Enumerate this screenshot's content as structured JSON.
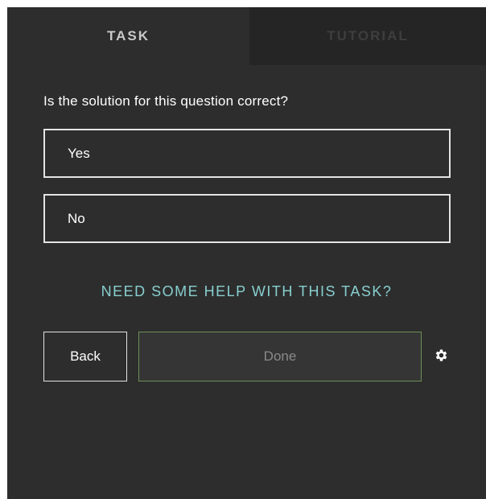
{
  "tabs": [
    {
      "label": "TASK",
      "active": true
    },
    {
      "label": "TUTORIAL",
      "active": false
    }
  ],
  "task": {
    "question": "Is the solution for this question correct?",
    "answers": [
      "Yes",
      "No"
    ],
    "help_link": "NEED SOME HELP WITH THIS TASK?"
  },
  "footer": {
    "back_label": "Back",
    "done_label": "Done",
    "settings_icon": "gear-icon"
  },
  "colors": {
    "background": "#2d2d2d",
    "help_link": "#88cfcf",
    "done_border": "#6d8f55"
  }
}
